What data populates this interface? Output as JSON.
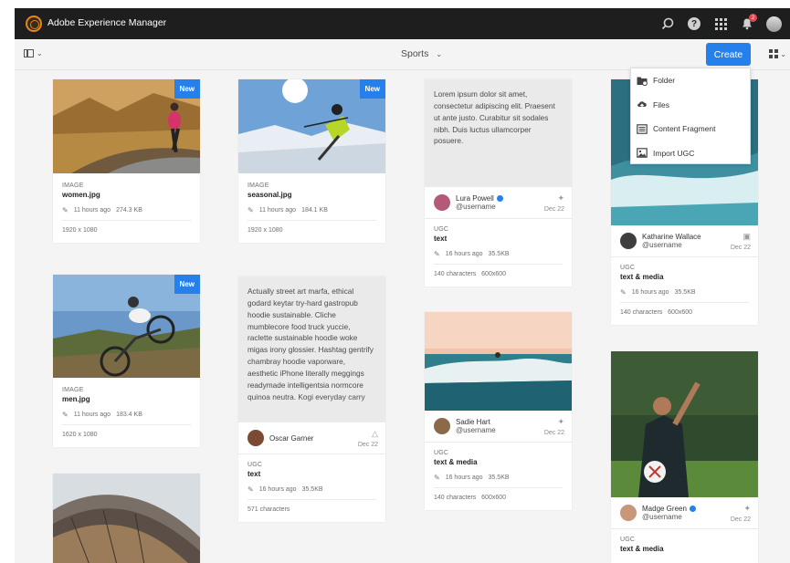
{
  "app": {
    "title": "Adobe Experience Manager",
    "notification_count": "2"
  },
  "actionbar": {
    "breadcrumb": "Sports",
    "create_label": "Create"
  },
  "create_menu": [
    {
      "label": "Folder",
      "icon": "folder-icon"
    },
    {
      "label": "Files",
      "icon": "upload-icon"
    },
    {
      "label": "Content Fragment",
      "icon": "fragment-icon"
    },
    {
      "label": "Import UGC",
      "icon": "import-icon"
    }
  ],
  "cards": {
    "women": {
      "badge": "New",
      "type": "IMAGE",
      "name": "women.jpg",
      "modified": "11 hours ago",
      "size": "274.3 KB",
      "dims": "1920 x 1080"
    },
    "seasonal": {
      "badge": "New",
      "type": "IMAGE",
      "name": "seasonal.jpg",
      "modified": "11 hours ago",
      "size": "184.1 KB",
      "dims": "1920 x 1080"
    },
    "men": {
      "badge": "New",
      "type": "IMAGE",
      "name": "men.jpg",
      "modified": "11 hours ago",
      "size": "183.4 KB",
      "dims": "1620 x 1080"
    },
    "lura": {
      "text": "Lorem ipsum dolor sit amet, consectetur adipiscing elit. Praesent ut ante justo. Curabitur sit sodales nibh. Duis luctus ullamcorper posuere.",
      "person": "Lura Powell",
      "user": "@username",
      "date": "Dec 22",
      "type": "UGC",
      "name": "text",
      "modified": "16 hours ago",
      "size": "35.5KB",
      "chars": "140 characters",
      "dims": "600x600"
    },
    "oscar": {
      "text": "Actually street art marfa, ethical godard keytar try-hard gastropub hoodie sustainable. Cliche mumblecore food truck yuccie, raclette sustainable hoodie woke migas irony glossier. Hashtag gentrify chambray hoodie vaporware, aesthetic iPhone literally meggings readymade intelligentsia normcore quinoa neutra. Kogi everyday carry",
      "person": "Oscar Garner",
      "date": "Dec 22",
      "type": "UGC",
      "name": "text",
      "modified": "16 hours ago",
      "size": "35.5KB",
      "chars": "571 characters"
    },
    "sadie": {
      "person": "Sadie Hart",
      "user": "@username",
      "date": "Dec 22",
      "type": "UGC",
      "name": "text & media",
      "modified": "16 hours ago",
      "size": "35.5KB",
      "chars": "140 characters",
      "dims": "600x600"
    },
    "katharine": {
      "person": "Katharine Wallace",
      "user": "@username",
      "date": "Dec 22",
      "type": "UGC",
      "name": "text & media",
      "modified": "16 hours ago",
      "size": "35.5KB",
      "chars": "140 characters",
      "dims": "600x600"
    },
    "madge": {
      "person": "Madge Green",
      "user": "@username",
      "date": "Dec 22",
      "type": "UGC",
      "name": "text & media"
    }
  },
  "colors": {
    "accent": "#2680eb",
    "topbar": "#1e1e1e",
    "background": "#f4f4f4"
  }
}
